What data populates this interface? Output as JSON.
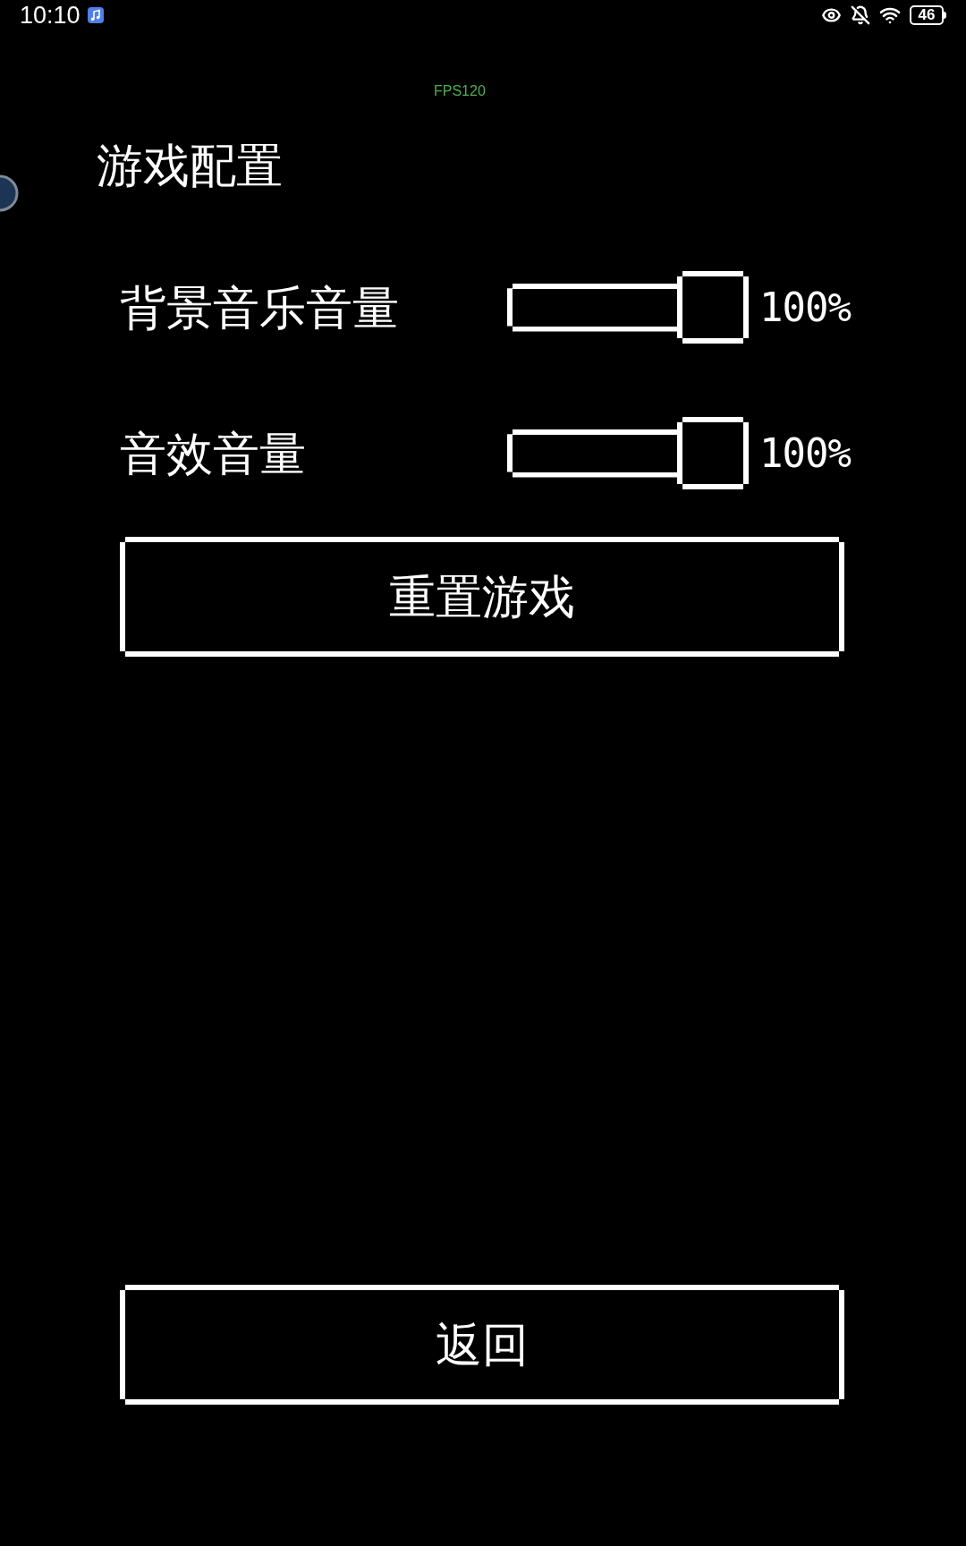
{
  "status_bar": {
    "time": "10:10",
    "battery": "46"
  },
  "fps": "FPS120",
  "title": "游戏配置",
  "settings": [
    {
      "label": "背景音乐音量",
      "level": 1,
      "reading": "100%"
    },
    {
      "label": "音效音量",
      "level": 1,
      "reading": "100%"
    }
  ],
  "buttons": [
    "重置游戏",
    "返回"
  ]
}
